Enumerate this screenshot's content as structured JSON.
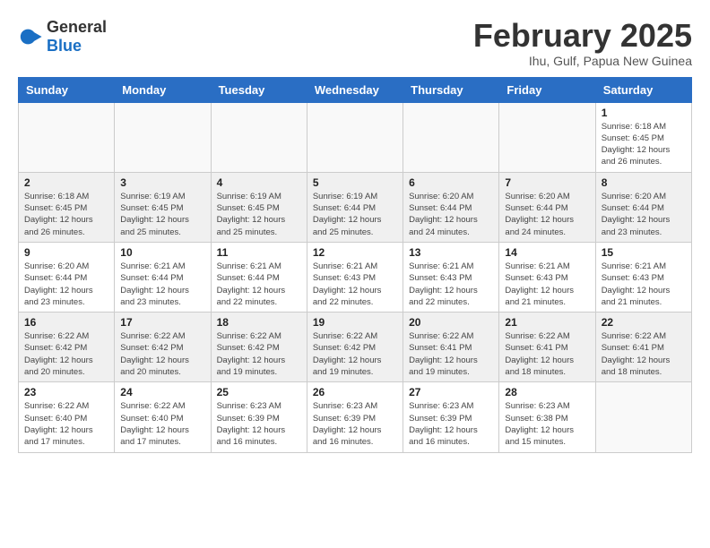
{
  "logo": {
    "general": "General",
    "blue": "Blue"
  },
  "title": "February 2025",
  "subtitle": "Ihu, Gulf, Papua New Guinea",
  "days_of_week": [
    "Sunday",
    "Monday",
    "Tuesday",
    "Wednesday",
    "Thursday",
    "Friday",
    "Saturday"
  ],
  "weeks": [
    {
      "shaded": false,
      "days": [
        {
          "num": "",
          "detail": ""
        },
        {
          "num": "",
          "detail": ""
        },
        {
          "num": "",
          "detail": ""
        },
        {
          "num": "",
          "detail": ""
        },
        {
          "num": "",
          "detail": ""
        },
        {
          "num": "",
          "detail": ""
        },
        {
          "num": "1",
          "detail": "Sunrise: 6:18 AM\nSunset: 6:45 PM\nDaylight: 12 hours and 26 minutes."
        }
      ]
    },
    {
      "shaded": true,
      "days": [
        {
          "num": "2",
          "detail": "Sunrise: 6:18 AM\nSunset: 6:45 PM\nDaylight: 12 hours and 26 minutes."
        },
        {
          "num": "3",
          "detail": "Sunrise: 6:19 AM\nSunset: 6:45 PM\nDaylight: 12 hours and 25 minutes."
        },
        {
          "num": "4",
          "detail": "Sunrise: 6:19 AM\nSunset: 6:45 PM\nDaylight: 12 hours and 25 minutes."
        },
        {
          "num": "5",
          "detail": "Sunrise: 6:19 AM\nSunset: 6:44 PM\nDaylight: 12 hours and 25 minutes."
        },
        {
          "num": "6",
          "detail": "Sunrise: 6:20 AM\nSunset: 6:44 PM\nDaylight: 12 hours and 24 minutes."
        },
        {
          "num": "7",
          "detail": "Sunrise: 6:20 AM\nSunset: 6:44 PM\nDaylight: 12 hours and 24 minutes."
        },
        {
          "num": "8",
          "detail": "Sunrise: 6:20 AM\nSunset: 6:44 PM\nDaylight: 12 hours and 23 minutes."
        }
      ]
    },
    {
      "shaded": false,
      "days": [
        {
          "num": "9",
          "detail": "Sunrise: 6:20 AM\nSunset: 6:44 PM\nDaylight: 12 hours and 23 minutes."
        },
        {
          "num": "10",
          "detail": "Sunrise: 6:21 AM\nSunset: 6:44 PM\nDaylight: 12 hours and 23 minutes."
        },
        {
          "num": "11",
          "detail": "Sunrise: 6:21 AM\nSunset: 6:44 PM\nDaylight: 12 hours and 22 minutes."
        },
        {
          "num": "12",
          "detail": "Sunrise: 6:21 AM\nSunset: 6:43 PM\nDaylight: 12 hours and 22 minutes."
        },
        {
          "num": "13",
          "detail": "Sunrise: 6:21 AM\nSunset: 6:43 PM\nDaylight: 12 hours and 22 minutes."
        },
        {
          "num": "14",
          "detail": "Sunrise: 6:21 AM\nSunset: 6:43 PM\nDaylight: 12 hours and 21 minutes."
        },
        {
          "num": "15",
          "detail": "Sunrise: 6:21 AM\nSunset: 6:43 PM\nDaylight: 12 hours and 21 minutes."
        }
      ]
    },
    {
      "shaded": true,
      "days": [
        {
          "num": "16",
          "detail": "Sunrise: 6:22 AM\nSunset: 6:42 PM\nDaylight: 12 hours and 20 minutes."
        },
        {
          "num": "17",
          "detail": "Sunrise: 6:22 AM\nSunset: 6:42 PM\nDaylight: 12 hours and 20 minutes."
        },
        {
          "num": "18",
          "detail": "Sunrise: 6:22 AM\nSunset: 6:42 PM\nDaylight: 12 hours and 19 minutes."
        },
        {
          "num": "19",
          "detail": "Sunrise: 6:22 AM\nSunset: 6:42 PM\nDaylight: 12 hours and 19 minutes."
        },
        {
          "num": "20",
          "detail": "Sunrise: 6:22 AM\nSunset: 6:41 PM\nDaylight: 12 hours and 19 minutes."
        },
        {
          "num": "21",
          "detail": "Sunrise: 6:22 AM\nSunset: 6:41 PM\nDaylight: 12 hours and 18 minutes."
        },
        {
          "num": "22",
          "detail": "Sunrise: 6:22 AM\nSunset: 6:41 PM\nDaylight: 12 hours and 18 minutes."
        }
      ]
    },
    {
      "shaded": false,
      "days": [
        {
          "num": "23",
          "detail": "Sunrise: 6:22 AM\nSunset: 6:40 PM\nDaylight: 12 hours and 17 minutes."
        },
        {
          "num": "24",
          "detail": "Sunrise: 6:22 AM\nSunset: 6:40 PM\nDaylight: 12 hours and 17 minutes."
        },
        {
          "num": "25",
          "detail": "Sunrise: 6:23 AM\nSunset: 6:39 PM\nDaylight: 12 hours and 16 minutes."
        },
        {
          "num": "26",
          "detail": "Sunrise: 6:23 AM\nSunset: 6:39 PM\nDaylight: 12 hours and 16 minutes."
        },
        {
          "num": "27",
          "detail": "Sunrise: 6:23 AM\nSunset: 6:39 PM\nDaylight: 12 hours and 16 minutes."
        },
        {
          "num": "28",
          "detail": "Sunrise: 6:23 AM\nSunset: 6:38 PM\nDaylight: 12 hours and 15 minutes."
        },
        {
          "num": "",
          "detail": ""
        }
      ]
    }
  ]
}
